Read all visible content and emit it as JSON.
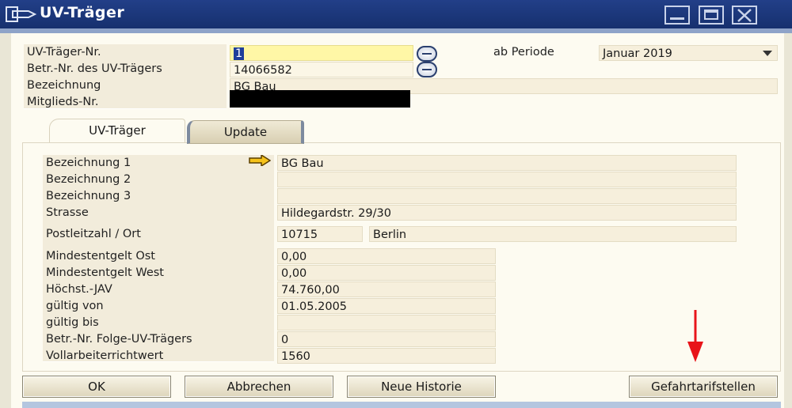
{
  "window": {
    "title": "UV-Träger"
  },
  "header": {
    "uv_nr_label": "UV-Träger-Nr.",
    "uv_nr_value": "1",
    "betr_nr_label": "Betr.-Nr. des UV-Trägers",
    "betr_nr_value": "14066582",
    "bezeichnung_label": "Bezeichnung",
    "bezeichnung_value": "BG Bau",
    "mitglieds_label": "Mitglieds-Nr.",
    "periode_label": "ab Periode",
    "periode_value": "Januar 2019"
  },
  "tabs": {
    "tab1": "UV-Träger",
    "tab2": "Update"
  },
  "details": {
    "bez1_label": "Bezeichnung 1",
    "bez1_value": "BG Bau",
    "bez2_label": "Bezeichnung 2",
    "bez2_value": "",
    "bez3_label": "Bezeichnung 3",
    "bez3_value": "",
    "strasse_label": "Strasse",
    "strasse_value": "Hildegardstr. 29/30",
    "plz_label": "Postleitzahl / Ort",
    "plz_value": "10715",
    "ort_value": "Berlin",
    "min_ost_label": "Mindestentgelt Ost",
    "min_ost_value": "0,00",
    "min_west_label": "Mindestentgelt West",
    "min_west_value": "0,00",
    "jav_label": "Höchst.-JAV",
    "jav_value": "74.760,00",
    "von_label": "gültig von",
    "von_value": "01.05.2005",
    "bis_label": "gültig bis",
    "bis_value": "",
    "folge_label": "Betr.-Nr. Folge-UV-Trägers",
    "folge_value": "0",
    "vollarb_label": "Vollarbeiterrichtwert",
    "vollarb_value": "1560"
  },
  "buttons": {
    "ok": "OK",
    "cancel": "Abbrechen",
    "history": "Neue Historie",
    "gefahr": "Gefahrtarifstellen"
  }
}
